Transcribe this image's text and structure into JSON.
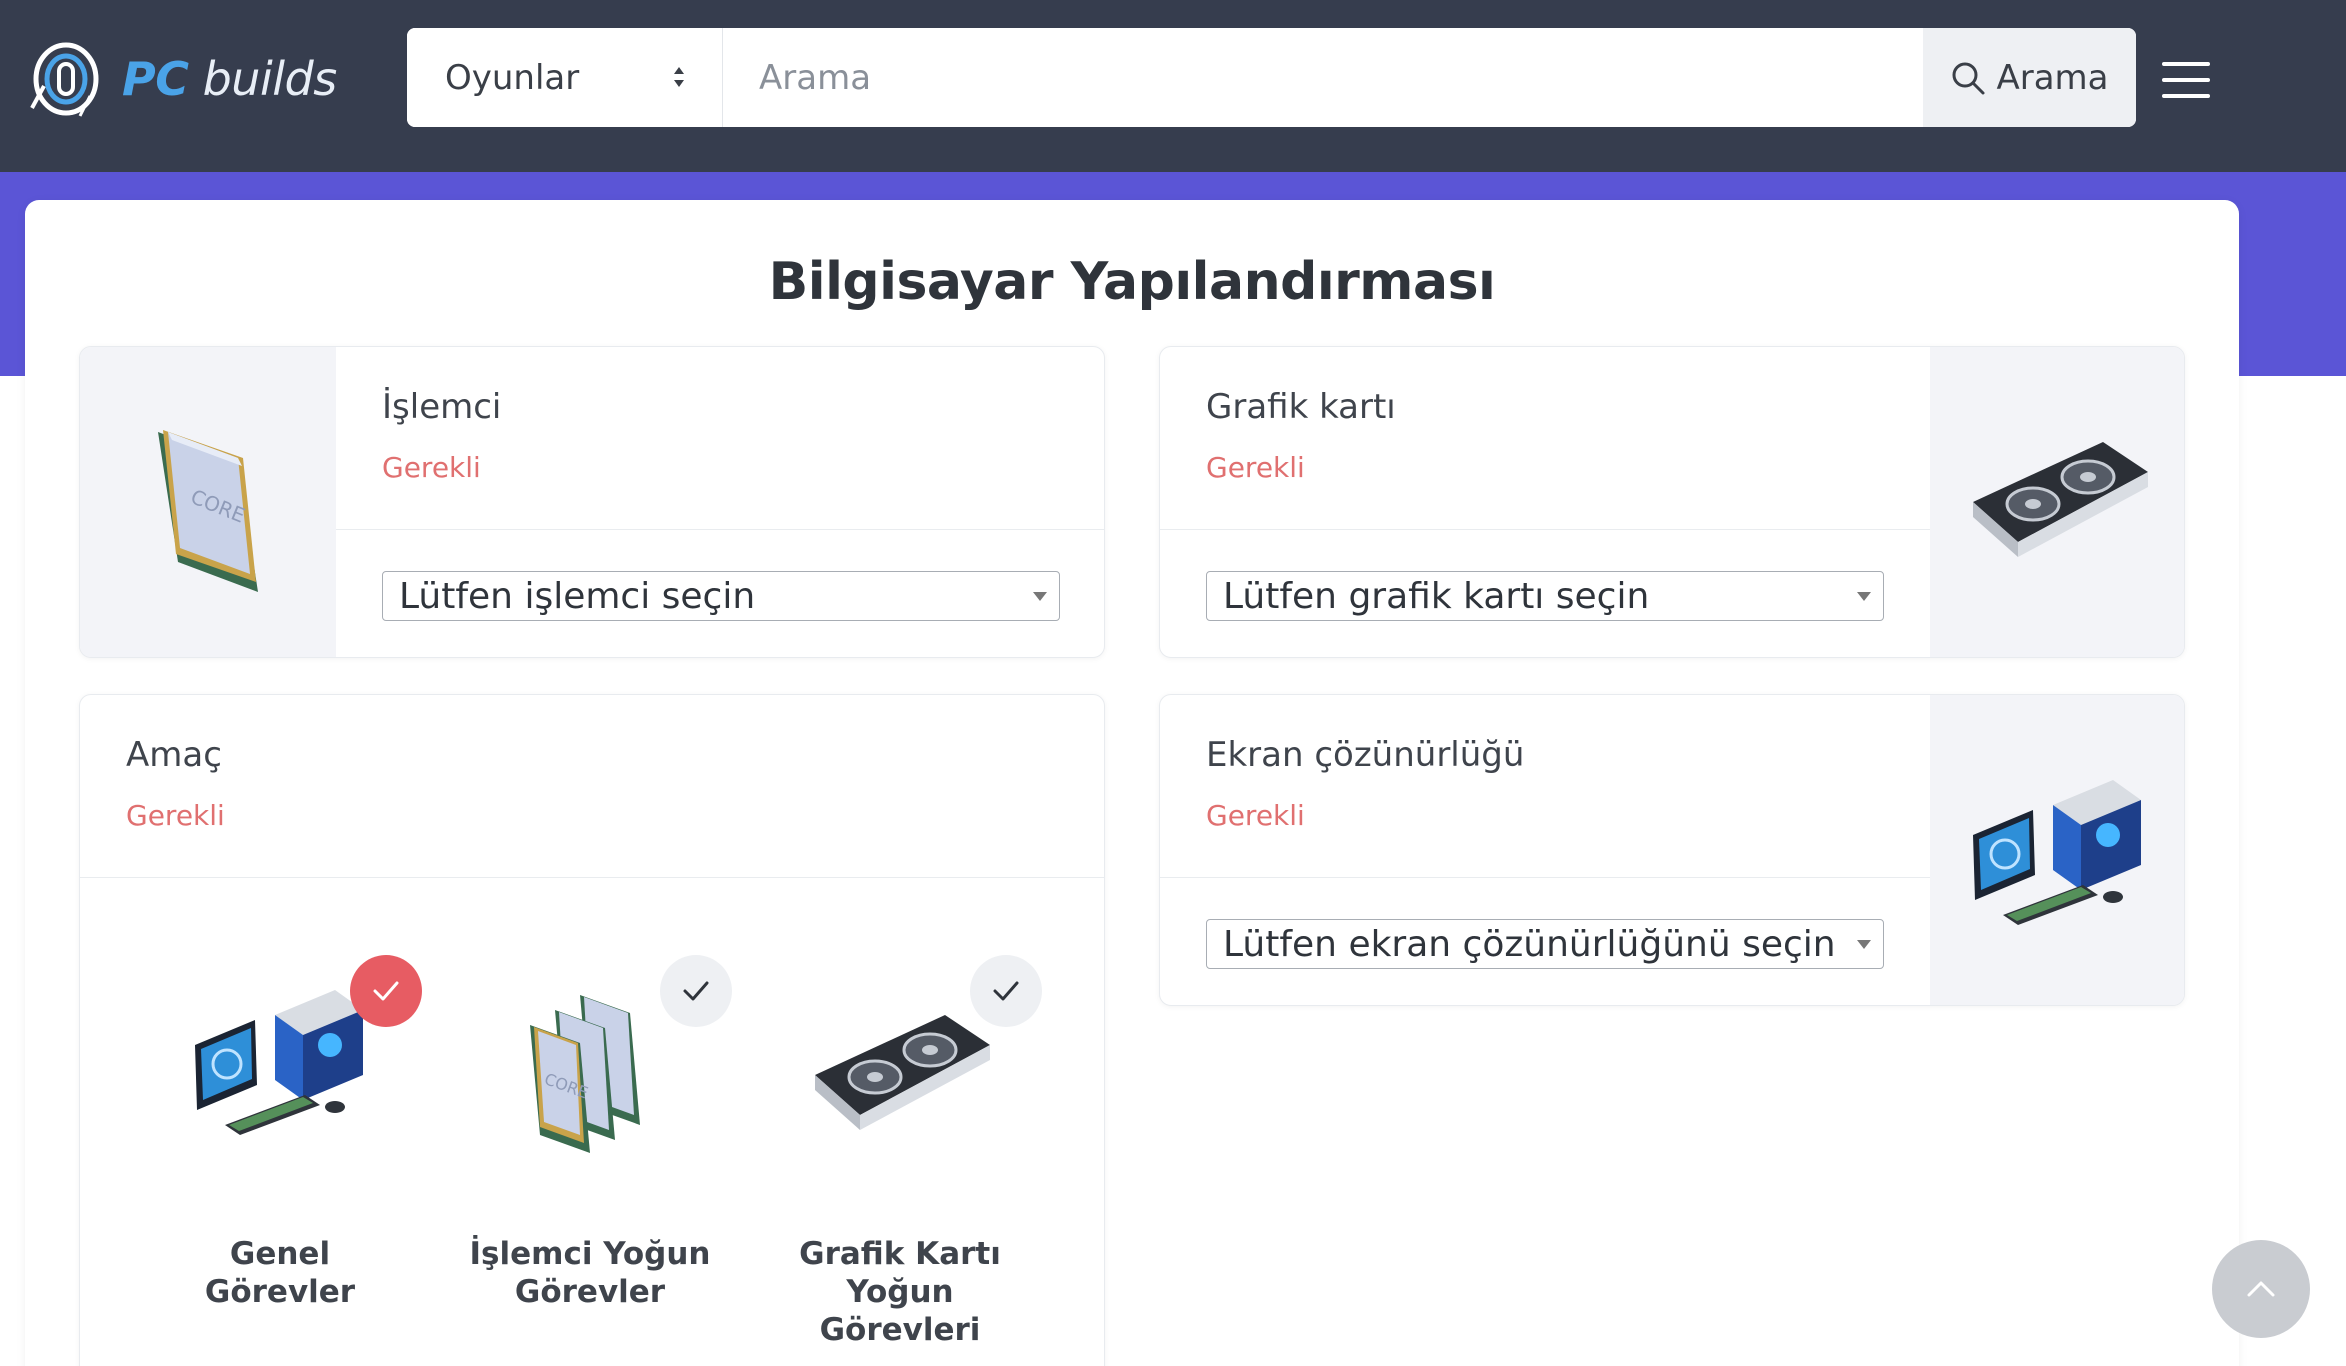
{
  "header": {
    "logo_pc": "PC",
    "logo_builds": " builds",
    "category_select": "Oyunlar",
    "search_placeholder": "Arama",
    "search_button": "Arama"
  },
  "page": {
    "title": "Bilgisayar Yapılandırması"
  },
  "cards": {
    "cpu": {
      "label": "İşlemci",
      "required": "Gerekli",
      "select": "Lütfen işlemci seçin"
    },
    "gpu": {
      "label": "Grafik kartı",
      "required": "Gerekli",
      "select": "Lütfen grafik kartı seçin"
    },
    "purpose": {
      "label": "Amaç",
      "required": "Gerekli"
    },
    "resolution": {
      "label": "Ekran çözünürlüğü",
      "required": "Gerekli",
      "select": "Lütfen ekran çözünürlüğünü seçin"
    }
  },
  "purpose_options": [
    {
      "label": "Genel Görevler",
      "selected": true
    },
    {
      "label": "İşlemci Yoğun Görevler",
      "selected": false
    },
    {
      "label": "Grafik Kartı Yoğun Görevleri",
      "selected": false
    }
  ],
  "icons": {
    "logo": "pc-builds-logo-icon",
    "search": "search-icon",
    "menu": "hamburger-menu-icon",
    "check": "check-icon",
    "scroll_top": "chevron-up-icon"
  },
  "colors": {
    "header_bg": "#363d4e",
    "accent_band": "#5b55d6",
    "required_text": "#e07070",
    "selected_badge": "#e75c63",
    "logo_accent": "#4aa3e8"
  }
}
